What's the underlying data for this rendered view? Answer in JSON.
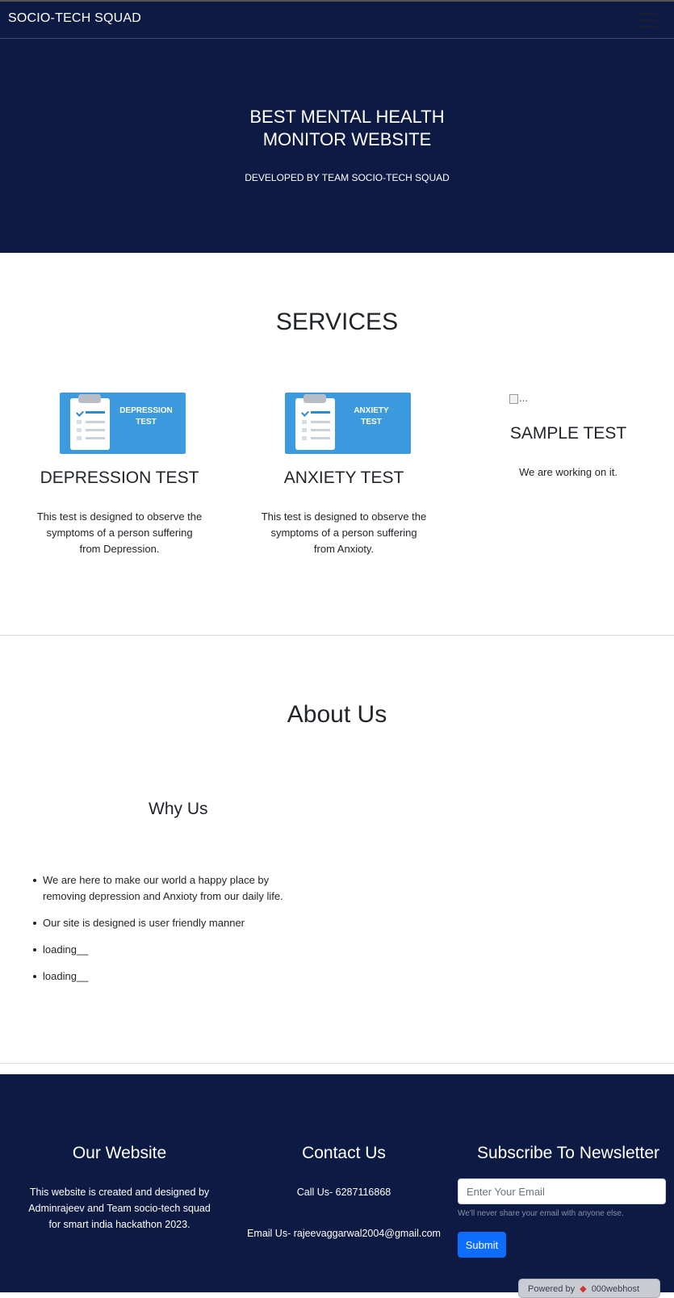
{
  "navbar": {
    "brand": "SOCIO-TECH SQUAD",
    "menu_icon": "hamburger-icon"
  },
  "hero": {
    "title": "BEST MENTAL HEALTH MONITOR WEBSITE",
    "subtitle": "DEVELOPED BY TEAM SOCIO-TECH SQUAD"
  },
  "services": {
    "title": "SERVICES",
    "items": [
      {
        "image_label_line1": "DEPRESSION",
        "image_label_line2": "TEST",
        "heading": "DEPRESSION TEST",
        "description": "This test is designed to observe the symptoms of a person suffering from Depression."
      },
      {
        "image_label_line1": "ANXIETY",
        "image_label_line2": "TEST",
        "heading": "ANXIETY TEST",
        "description": "This test is designed to observe the symptoms of a person suffering from Anxioty."
      },
      {
        "image_alt": "...",
        "heading": "SAMPLE TEST",
        "description": "We are working on it."
      }
    ]
  },
  "about": {
    "title": "About Us",
    "why_title": "Why Us",
    "points": [
      "We are here to make our world a happy place by removing depression and Anxioty from our daily life.",
      "Our site is designed is user friendly manner",
      "loading__",
      "loading__"
    ]
  },
  "footer": {
    "website": {
      "heading": "Our Website",
      "text": "This website is created and designed by Adminrajeev and Team socio-tech squad for smart india hackathon 2023."
    },
    "contact": {
      "heading": "Contact Us",
      "phone": "Call Us- 6287116868",
      "email": "Email Us- rajeevaggarwal2004@gmail.com"
    },
    "newsletter": {
      "heading": "Subscribe To Newsletter",
      "placeholder": "Enter Your Email",
      "help": "We'll never share your email with anyone else.",
      "submit_label": "Submit"
    },
    "powered_by": {
      "prefix": "Powered by",
      "brand": "000webhost"
    }
  },
  "colors": {
    "navy": "#0d1a44",
    "primary": "#0d6efd",
    "card_blue": "#3c9ade"
  }
}
